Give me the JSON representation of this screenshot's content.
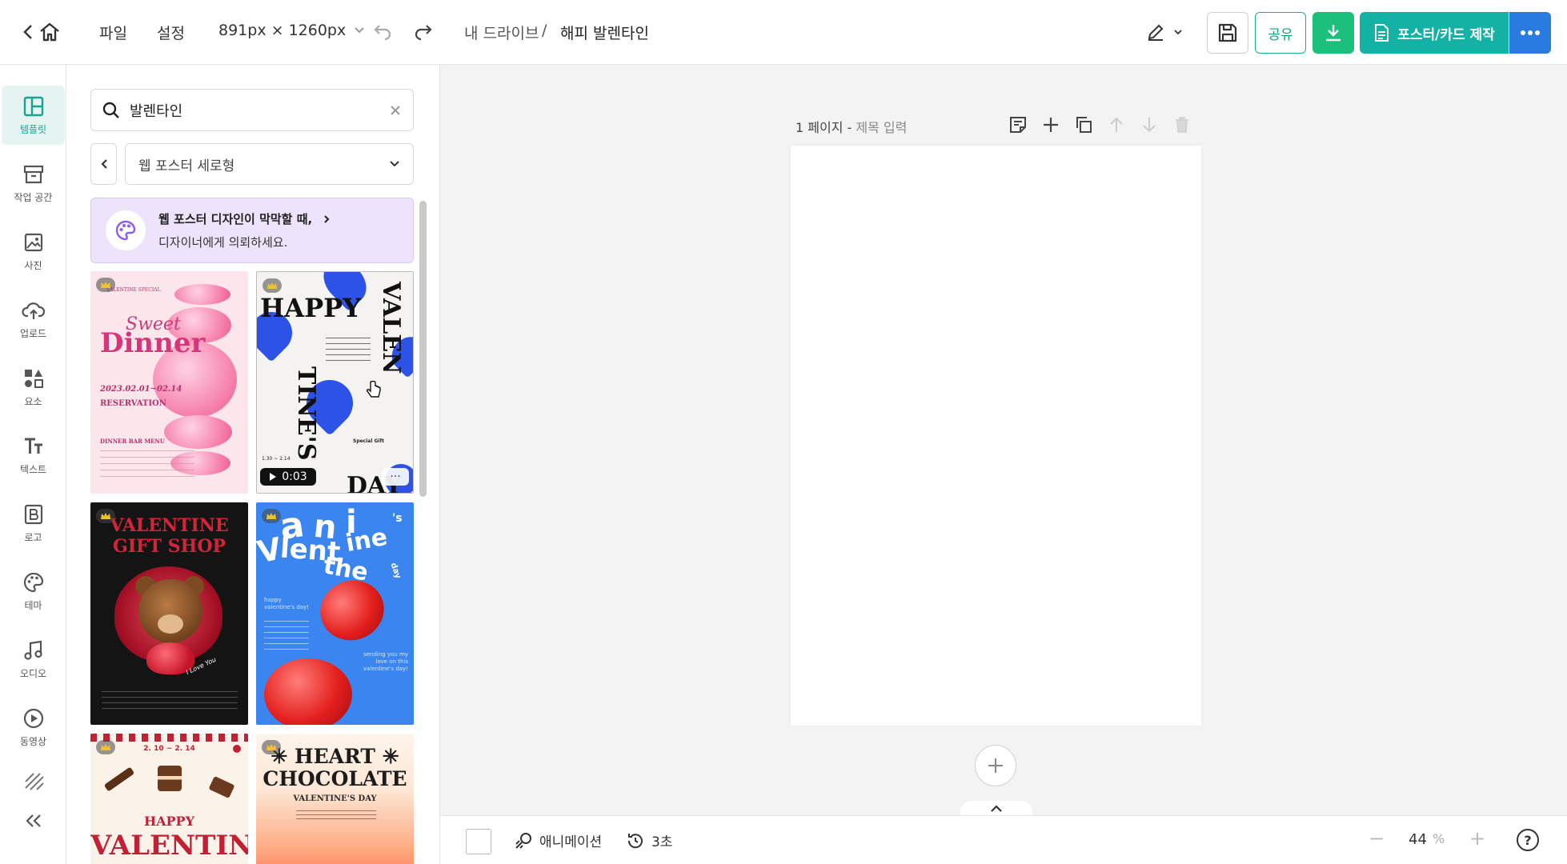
{
  "topbar": {
    "menu_file": "파일",
    "menu_settings": "설정",
    "size_label": "891px × 1260px",
    "breadcrumb_root": "내 드라이브",
    "breadcrumb_sep": "/",
    "doc_title": "해피 발렌타인",
    "share_label": "공유",
    "make_label": "포스터/카드 제작"
  },
  "rail": {
    "items": [
      {
        "label": "템플릿",
        "icon": "layout-icon",
        "active": true
      },
      {
        "label": "작업 공간",
        "icon": "archive-icon"
      },
      {
        "label": "사진",
        "icon": "image-icon"
      },
      {
        "label": "업로드",
        "icon": "cloud-upload-icon"
      },
      {
        "label": "요소",
        "icon": "shapes-icon"
      },
      {
        "label": "텍스트",
        "icon": "text-icon"
      },
      {
        "label": "로고",
        "icon": "logo-b-icon"
      },
      {
        "label": "테마",
        "icon": "palette-icon"
      },
      {
        "label": "오디오",
        "icon": "music-icon"
      },
      {
        "label": "동영상",
        "icon": "play-circle-icon"
      }
    ]
  },
  "panel": {
    "search_value": "발렌타인",
    "category": "웹 포스터 세로형",
    "promo_title": "웹 포스터 디자인이 막막할 때,",
    "promo_sub": "디자이너에게 의뢰하세요.",
    "templates": {
      "t1": {
        "script": "Sweet",
        "title": "Dinner",
        "top": "VALENTINE SPECIAL",
        "date": "2023.02.01~02.14",
        "res": "RESERVATION",
        "menu": "DINNER BAR MENU"
      },
      "t2": {
        "happy": "HAPPY",
        "valen": "VALEN",
        "tines": "TINE'S",
        "day": "DAY",
        "duration": "0:03",
        "gift": "Special Gift",
        "date": "1.30 ~ 2.14"
      },
      "t3": {
        "title1": "VALENTINE",
        "title2": "GIFT SHOP",
        "script": "I Love You"
      },
      "t4": {
        "w1": "a",
        "w2": "n",
        "w3": "i",
        "w4": "'s",
        "w5": "V",
        "w6": "lent",
        "w7": "ine",
        "w8": "the",
        "w9": "day",
        "small1": "happy valentine's day!",
        "small2": "sending you my love on this valentine's day!"
      },
      "t5": {
        "date": "2. 10 ~ 2. 14",
        "happy": "HAPPY",
        "valentines": "VALENTINE'S"
      },
      "t6": {
        "heart": "HEART",
        "chocolate": "CHOCOLATE",
        "sub": "VALENTINE'S DAY"
      }
    }
  },
  "canvas": {
    "page_label": "1 페이지 -",
    "page_title_placeholder": "제목 입력"
  },
  "bottombar": {
    "animation_label": "애니메이션",
    "duration_label": "3초",
    "zoom_value": "44",
    "zoom_unit": "%",
    "help": "?"
  },
  "colors": {
    "accent": "#13b2a5",
    "download": "#1cc07c",
    "more": "#2a7be0",
    "share": "#11a37a"
  }
}
